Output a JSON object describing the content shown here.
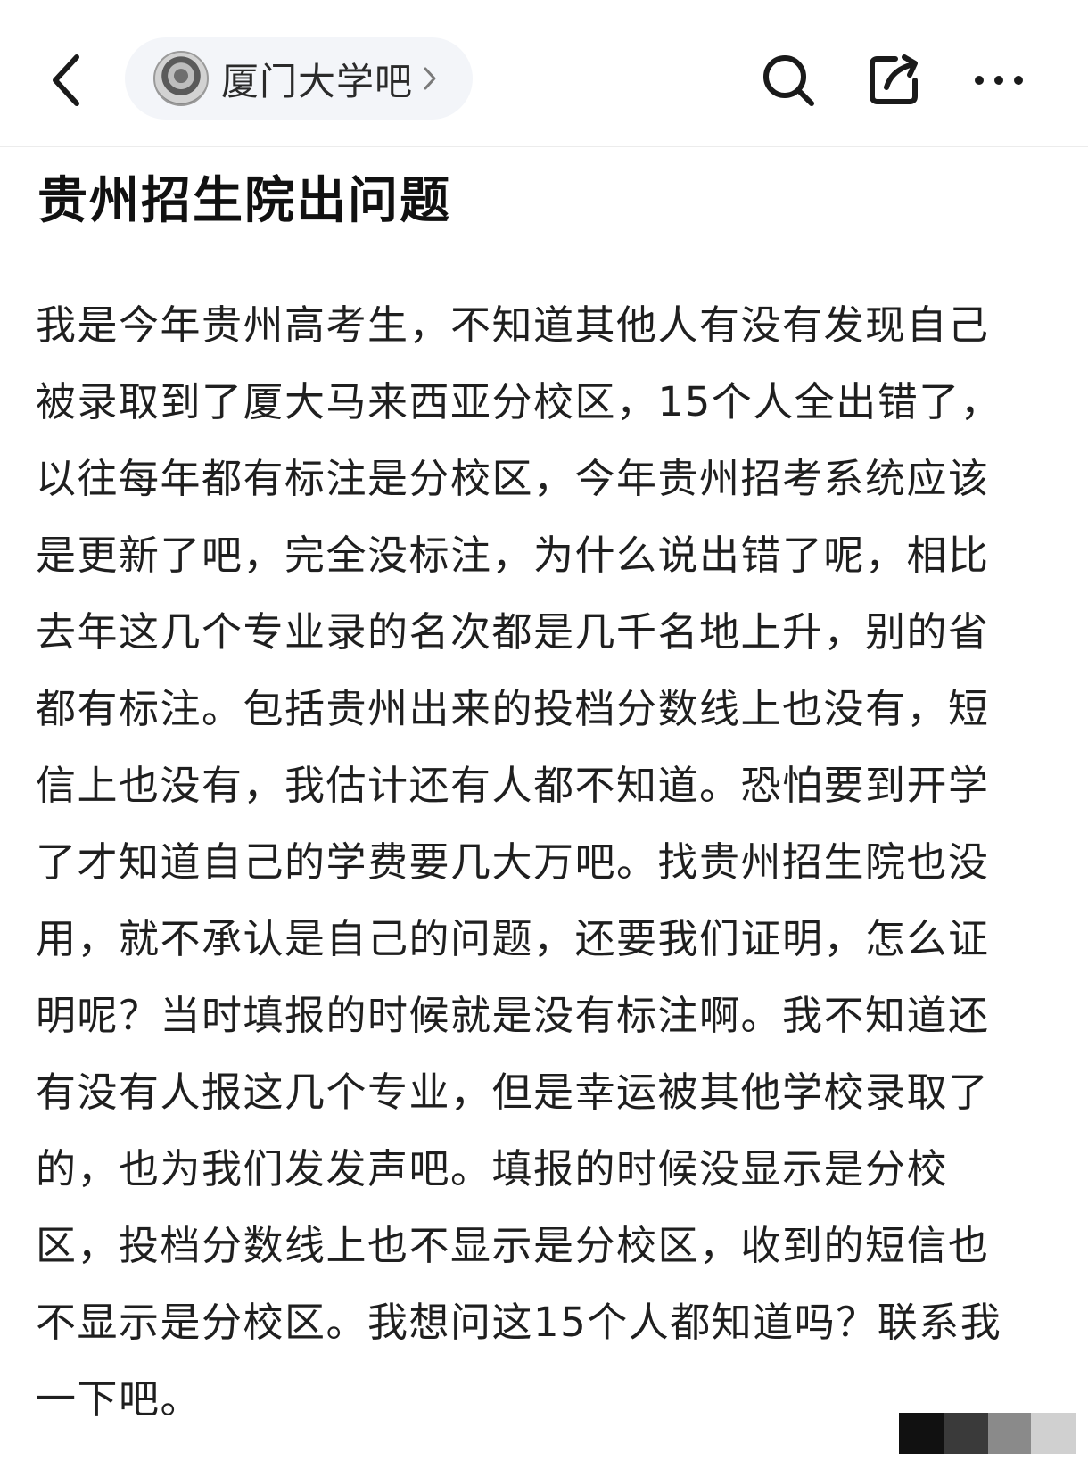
{
  "header": {
    "forum_name": "厦门大学吧",
    "icons": {
      "back": "back-arrow-icon",
      "forum_avatar": "university-seal-icon",
      "chevron": "chevron-right-icon",
      "search": "search-icon",
      "share": "share-icon",
      "more": "more-icon"
    }
  },
  "post": {
    "title": "贵州招生院出问题",
    "body_lines": [
      "我是今年贵州高考生，不知道其他人有没有发现自己",
      "被录取到了厦大马来西亚分校区，15个人全出错了，",
      "以往每年都有标注是分校区，今年贵州招考系统应该",
      "是更新了吧，完全没标注，为什么说出错了呢，相比",
      "去年这几个专业录的名次都是几千名地上升，别的省",
      "都有标注。包括贵州出来的投档分数线上也没有，短",
      "信上也没有，我估计还有人都不知道。恐怕要到开学",
      "了才知道自己的学费要几大万吧。找贵州招生院也没",
      "用，就不承认是自己的问题，还要我们证明，怎么证",
      "明呢？当时填报的时候就是没有标注啊。我不知道还",
      "有没有人报这几个专业，但是幸运被其他学校录取了",
      "的，也为我们发发声吧。填报的时候没显示是分校",
      "区，投档分数线上也不显示是分校区，收到的短信也",
      "不显示是分校区。我想问这15个人都知道吗？联系我",
      "一下吧。"
    ]
  },
  "colors": {
    "text": "#1f1f1f",
    "title": "#111111",
    "pill_bg": "#f3f5f9",
    "divider": "#ececec",
    "watermark": [
      "#111111",
      "#3a3a3a",
      "#8a8a8a",
      "#d0d0d0"
    ]
  }
}
